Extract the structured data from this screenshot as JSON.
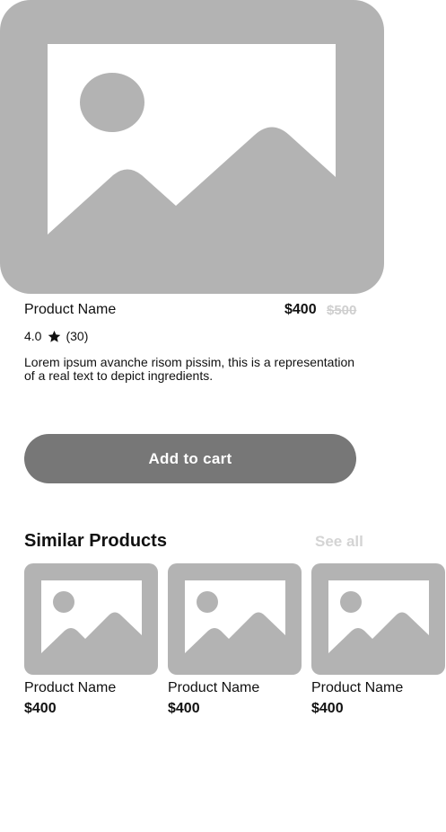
{
  "product": {
    "name": "Product Name",
    "price": "$400",
    "old_price": "$500",
    "rating": "4.0",
    "reviews": "(30)",
    "description": "Lorem ipsum avanche risom pissim, this is a representation of a real text to depict ingredients.",
    "image_icon": "image-placeholder-icon"
  },
  "actions": {
    "add_to_cart": "Add to cart"
  },
  "similar": {
    "title": "Similar Products",
    "see_all": "See all",
    "items": [
      {
        "name": "Product Name",
        "price": "$400"
      },
      {
        "name": "Product Name",
        "price": "$400"
      },
      {
        "name": "Product Name",
        "price": "$400"
      }
    ]
  },
  "colors": {
    "placeholder": "#b3b3b3",
    "button": "#777777",
    "muted": "#cfcfcf"
  }
}
